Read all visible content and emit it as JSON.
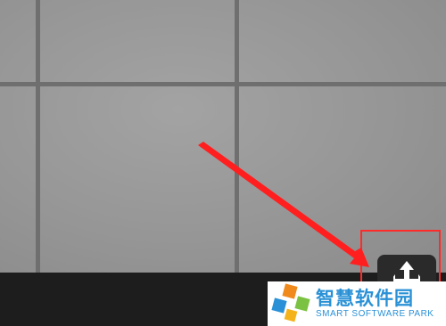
{
  "colors": {
    "highlight": "#ff2b2b",
    "arrow": "#ff1f1f",
    "watermark_text": "#2a91d6",
    "logo_orange": "#f08a1c",
    "logo_green": "#7cc242",
    "logo_blue": "#2a91d6"
  },
  "toolbar": {
    "move_button_icon": "move-arrows-icon"
  },
  "watermark": {
    "cn": "智慧软件园",
    "en": "SMART SOFTWARE PARK"
  }
}
